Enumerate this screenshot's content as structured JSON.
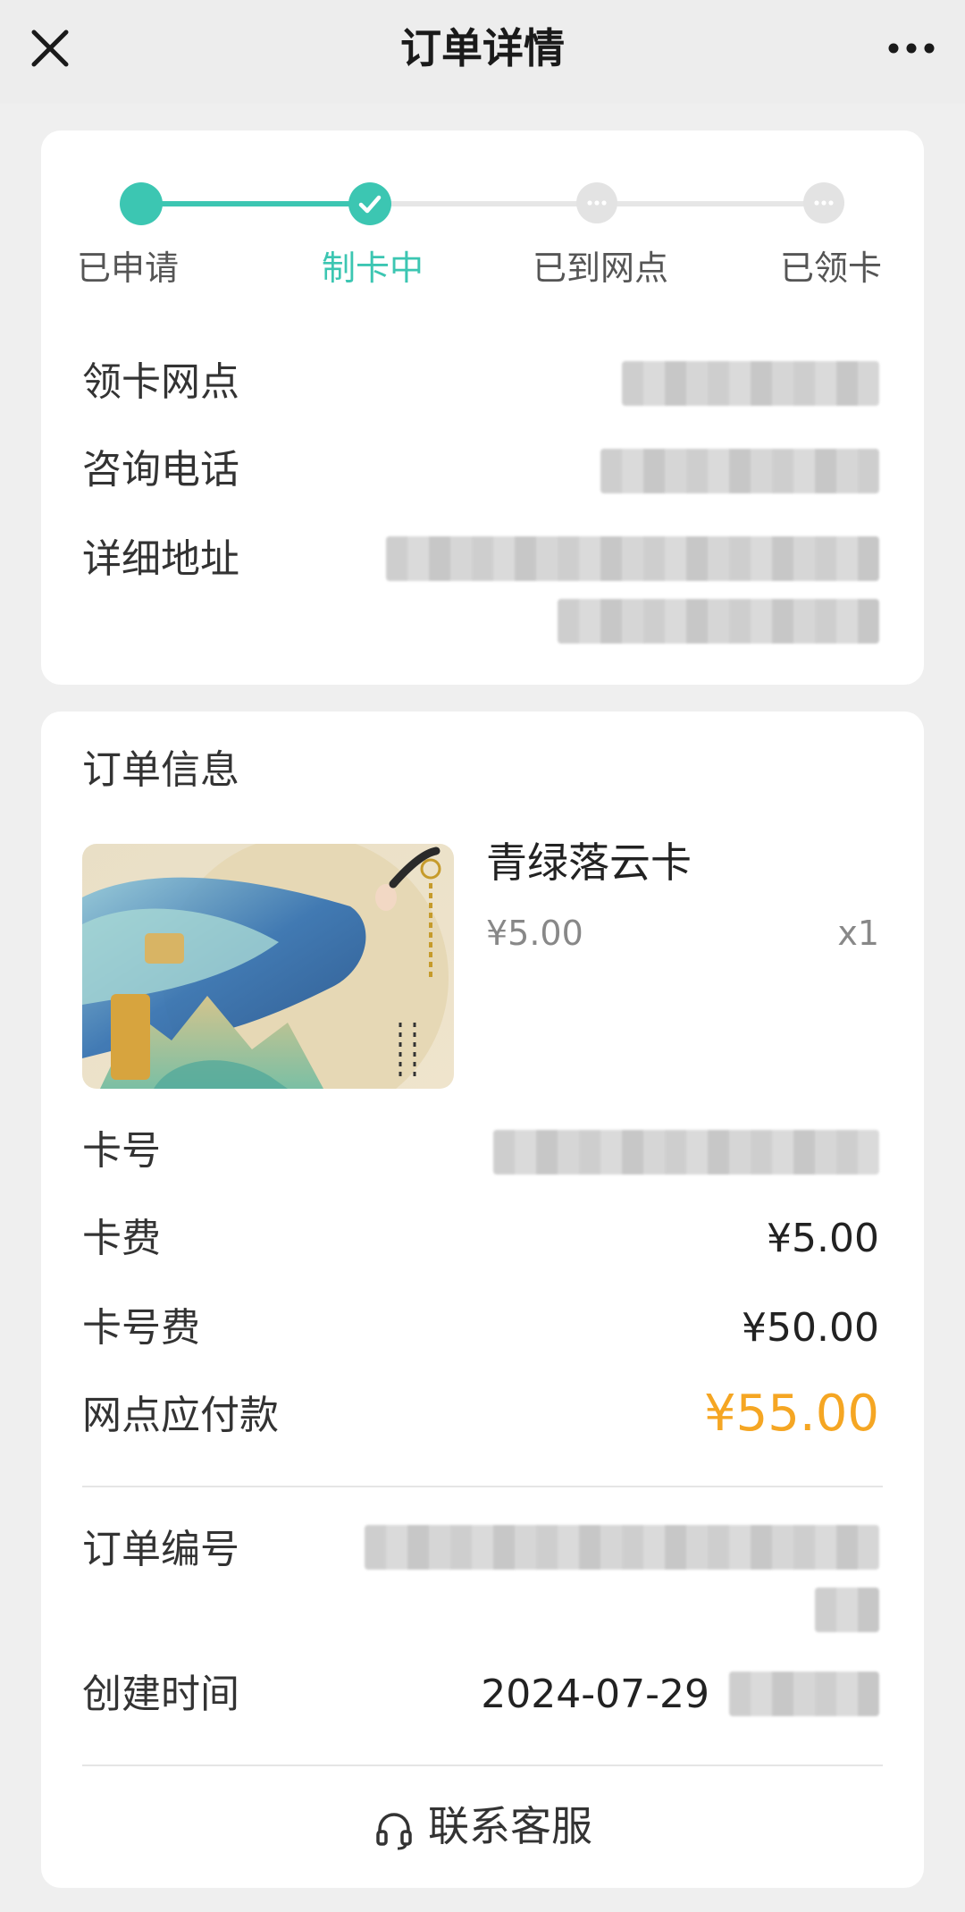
{
  "nav": {
    "title": "订单详情"
  },
  "progress": {
    "steps": [
      "已申请",
      "制卡中",
      "已到网点",
      "已领卡"
    ],
    "current_step": 2,
    "accent": "#3cc6b2"
  },
  "pickup": {
    "branch_label": "领卡网点",
    "phone_label": "咨询电话",
    "address_label": "详细地址"
  },
  "order": {
    "section_title": "订单信息",
    "product_name": "青绿落云卡",
    "product_price": "¥5.00",
    "product_qty": "x1",
    "card_no_label": "卡号",
    "card_fee_label": "卡费",
    "card_fee_value": "¥5.00",
    "number_fee_label": "卡号费",
    "number_fee_value": "¥50.00",
    "payable_label": "网点应付款",
    "payable_value": "¥55.00",
    "payable_color": "#f5a623",
    "order_no_label": "订单编号",
    "created_label": "创建时间",
    "created_value": "2024-07-29",
    "contact_label": "联系客服"
  }
}
